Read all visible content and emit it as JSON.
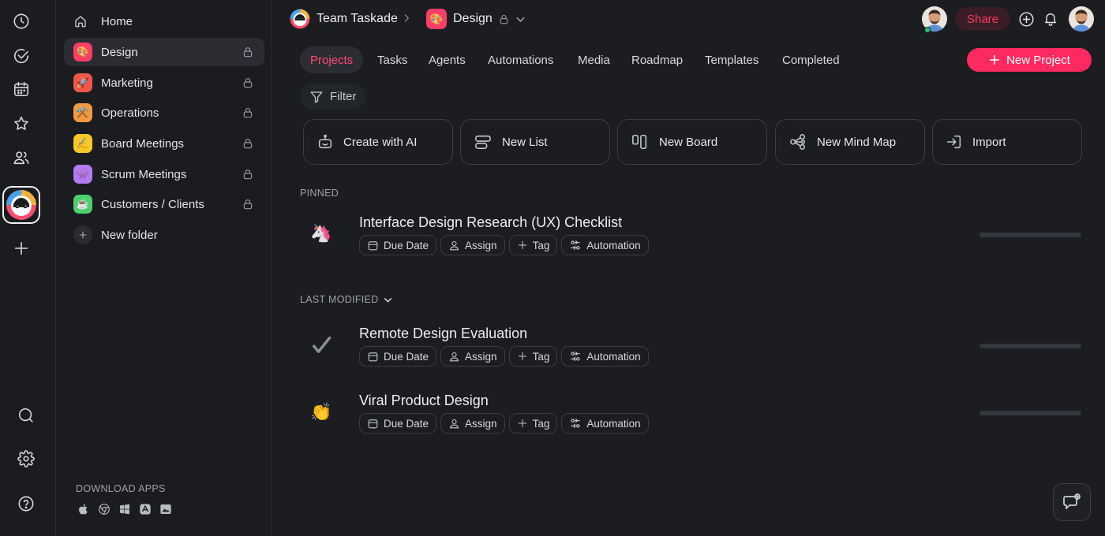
{
  "header": {
    "team_name": "Team Taskade",
    "space_name": "Design",
    "share_label": "Share"
  },
  "sidebar": {
    "home_label": "Home",
    "items": [
      {
        "label": "Design",
        "emoji": "🎨",
        "color": "#ff3e68"
      },
      {
        "label": "Marketing",
        "emoji": "🚀",
        "color": "#f0574a"
      },
      {
        "label": "Operations",
        "emoji": "⚒️",
        "color": "#f39a3e"
      },
      {
        "label": "Board Meetings",
        "emoji": "✍️",
        "color": "#f7c928"
      },
      {
        "label": "Scrum Meetings",
        "emoji": "👾",
        "color": "#b07cf0"
      },
      {
        "label": "Customers / Clients",
        "emoji": "☕",
        "color": "#4ccf6e"
      }
    ],
    "new_folder_label": "New folder",
    "download_title": "DOWNLOAD APPS"
  },
  "tabs": [
    "Projects",
    "Tasks",
    "Agents",
    "Automations",
    "Media",
    "Roadmap",
    "Templates",
    "Completed"
  ],
  "active_tab": "Projects",
  "new_project_label": "New Project",
  "filter_label": "Filter",
  "quick_create": [
    "Create with AI",
    "New List",
    "New Board",
    "New Mind Map",
    "Import"
  ],
  "pinned": {
    "title": "PINNED",
    "projects": [
      {
        "title": "Interface Design Research (UX) Checklist",
        "emoji": "🦄"
      }
    ]
  },
  "last_modified": {
    "title": "LAST MODIFIED",
    "projects": [
      {
        "title": "Remote Design Evaluation",
        "emoji": "✔️"
      },
      {
        "title": "Viral Product Design",
        "emoji": "👏"
      }
    ]
  },
  "chips": {
    "due_date": "Due Date",
    "assign": "Assign",
    "tag": "Tag",
    "automation": "Automation"
  },
  "colors": {
    "accent": "#ff2a5f",
    "background": "#1b1d21"
  }
}
